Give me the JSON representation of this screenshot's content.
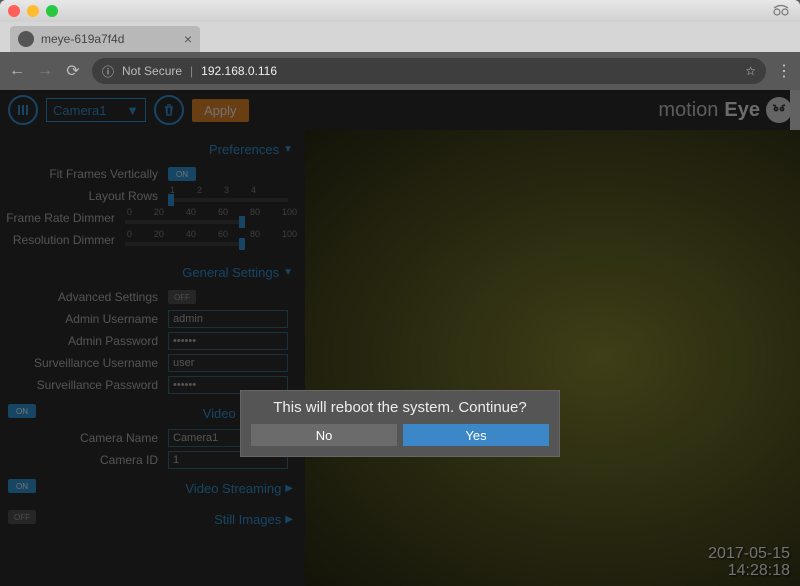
{
  "browser": {
    "tab_title": "meye-619a7f4d",
    "not_secure_label": "Not Secure",
    "url": "192.168.0.116"
  },
  "app": {
    "camera_selected": "Camera1",
    "apply_label": "Apply",
    "brand_prefix": "motion",
    "brand_suffix": "Eye"
  },
  "sections": {
    "preferences": {
      "title": "Preferences",
      "rows": {
        "fit_frames": "Fit Frames Vertically",
        "layout_rows": "Layout Rows",
        "frame_rate_dimmer": "Frame Rate Dimmer",
        "resolution_dimmer": "Resolution Dimmer"
      },
      "ticks_layout": [
        "1",
        "2",
        "3",
        "4"
      ],
      "ticks_pct": [
        "0",
        "20",
        "40",
        "60",
        "80",
        "100"
      ]
    },
    "general": {
      "title": "General Settings",
      "rows": {
        "advanced": "Advanced Settings",
        "admin_user": "Admin Username",
        "admin_user_val": "admin",
        "admin_pass": "Admin Password",
        "admin_pass_val": "••••••",
        "surv_user": "Surveillance Username",
        "surv_user_val": "user",
        "surv_pass": "Surveillance Password",
        "surv_pass_val": "••••••"
      }
    },
    "video_device": {
      "title": "Video Device",
      "rows": {
        "camera_name": "Camera Name",
        "camera_name_val": "Camera1",
        "camera_id": "Camera ID",
        "camera_id_val": "1"
      }
    },
    "video_streaming": {
      "title": "Video Streaming"
    },
    "still_images": {
      "title": "Still Images"
    }
  },
  "modal": {
    "message": "This will reboot the system. Continue?",
    "no": "No",
    "yes": "Yes"
  },
  "video": {
    "timestamp_date": "2017-05-15",
    "timestamp_time": "14:28:18"
  },
  "toggles": {
    "on": "ON",
    "off": "OFF"
  }
}
